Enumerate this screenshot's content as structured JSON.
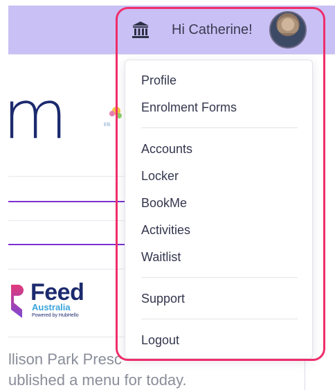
{
  "header": {
    "greeting": "Hi Catherine!",
    "institution_icon": "bank-icon",
    "avatar_icon": "user-avatar"
  },
  "background": {
    "title_fragment": "m",
    "logo_fragment_text": "Elli",
    "feed_logo": {
      "word": "Feed",
      "sub": "Australia",
      "powered": "Powered by HubHello"
    },
    "notice_line_1": "llison Park Presc",
    "notice_line_2": "ublished a menu for today."
  },
  "menu": {
    "group1": [
      {
        "label": "Profile"
      },
      {
        "label": "Enrolment Forms"
      }
    ],
    "group2": [
      {
        "label": "Accounts"
      },
      {
        "label": "Locker"
      },
      {
        "label": "BookMe"
      },
      {
        "label": "Activities"
      },
      {
        "label": "Waitlist"
      }
    ],
    "group3": [
      {
        "label": "Support"
      }
    ],
    "group4": [
      {
        "label": "Logout"
      }
    ]
  },
  "colors": {
    "header_bg": "#c9c0f5",
    "highlight": "#ef2d6b",
    "brand_navy": "#1c2a6e",
    "accent_purple": "#7b2fd0"
  }
}
